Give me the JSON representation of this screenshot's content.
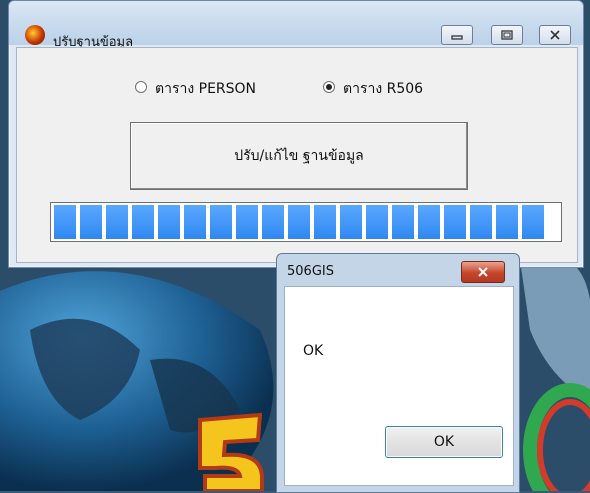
{
  "main_window": {
    "title": "ปรับฐานข้อมูล",
    "controls": {
      "minimize": "▭",
      "maximize": "▣",
      "close": "✕"
    },
    "radio_person_label": "ตาราง PERSON",
    "radio_r506_label": "ตาราง R506",
    "selected_radio": "r506",
    "fix_button_label": "ปรับ/แก้ไข ฐานข้อมูล",
    "progress_percent": 100
  },
  "dialog": {
    "title": "506GIS",
    "close_label": "✕",
    "message": "OK",
    "ok_label": "OK"
  },
  "colors": {
    "progress": "#2f88f0",
    "window_bg": "#dfe9f5",
    "close_red": "#c7452b"
  }
}
